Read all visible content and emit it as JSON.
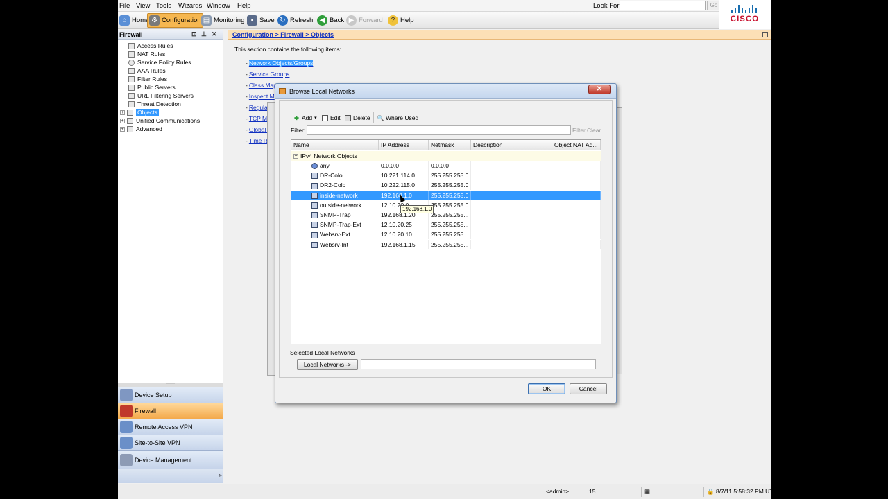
{
  "menubar": {
    "items": [
      "File",
      "View",
      "Tools",
      "Wizards",
      "Window",
      "Help"
    ],
    "look_for_label": "Look For:",
    "go_label": "Go",
    "logo_text": "CISCO"
  },
  "toolbar": {
    "home": "Home",
    "configuration": "Configuration",
    "monitoring": "Monitoring",
    "save": "Save",
    "refresh": "Refresh",
    "back": "Back",
    "forward": "Forward",
    "help": "Help"
  },
  "left_panel": {
    "title": "Firewall",
    "tree": [
      "Access Rules",
      "NAT Rules",
      "Service Policy Rules",
      "AAA Rules",
      "Filter Rules",
      "Public Servers",
      "URL Filtering Servers",
      "Threat Detection",
      "Objects",
      "Unified Communications",
      "Advanced"
    ],
    "selected": "Objects",
    "nav": [
      "Device Setup",
      "Firewall",
      "Remote Access VPN",
      "Site-to-Site VPN",
      "Device Management"
    ],
    "active_nav": "Firewall"
  },
  "content": {
    "breadcrumb": "Configuration > Firewall > Objects",
    "intro": "This section contains the following items:",
    "links": [
      "Network Objects/Groups",
      "Service Groups",
      "Class Maps",
      "Inspect Maps",
      "Regular Expressions",
      "TCP Maps",
      "Global Policies",
      "Time Ranges"
    ],
    "links_visible": [
      "Network Objects/Groups",
      "Service Groups",
      "Class Map",
      "Inspect M",
      "Regular Ex",
      "TCP Ma",
      "Global P",
      "Time Ra"
    ]
  },
  "dialog": {
    "title": "Browse Local Networks",
    "toolbar": {
      "add": "Add",
      "edit": "Edit",
      "delete": "Delete",
      "where_used": "Where Used"
    },
    "filter_label": "Filter:",
    "filter_value": "",
    "filter_button": "Filter",
    "clear_button": "Clear",
    "columns": [
      "Name",
      "IP Address",
      "Netmask",
      "Description",
      "Object NAT Ad..."
    ],
    "group_label": "IPv4 Network Objects",
    "rows": [
      {
        "name": "any",
        "ip": "0.0.0.0",
        "netmask": "0.0.0.0",
        "description": "",
        "nat": "",
        "icon": "any-icon"
      },
      {
        "name": "DR-Colo",
        "ip": "10.221.114.0",
        "netmask": "255.255.255.0",
        "description": "",
        "nat": "",
        "icon": "network-object-icon"
      },
      {
        "name": "DR2-Colo",
        "ip": "10.222.115.0",
        "netmask": "255.255.255.0",
        "description": "",
        "nat": "",
        "icon": "network-object-icon"
      },
      {
        "name": "inside-network",
        "ip": "192.168.1.0",
        "netmask": "255.255.255.0",
        "description": "",
        "nat": "",
        "icon": "network-object-icon"
      },
      {
        "name": "outside-network",
        "ip": "12.10.20.0",
        "netmask": "255.255.255.0",
        "description": "",
        "nat": "",
        "icon": "network-object-icon"
      },
      {
        "name": "SNMP-Trap",
        "ip": "192.168.1.20",
        "netmask": "255.255.255...",
        "description": "",
        "nat": "",
        "icon": "host-object-icon"
      },
      {
        "name": "SNMP-Trap-Ext",
        "ip": "12.10.20.25",
        "netmask": "255.255.255...",
        "description": "",
        "nat": "",
        "icon": "host-object-icon"
      },
      {
        "name": "Websrv-Ext",
        "ip": "12.10.20.10",
        "netmask": "255.255.255...",
        "description": "",
        "nat": "",
        "icon": "host-object-icon"
      },
      {
        "name": "Websrv-Int",
        "ip": "192.168.1.15",
        "netmask": "255.255.255...",
        "description": "",
        "nat": "",
        "icon": "host-object-icon"
      }
    ],
    "selected_row": "inside-network",
    "tooltip": "192.168.1.0",
    "selected_label": "Selected Local Networks",
    "local_networks_button": "Local Networks ->",
    "local_networks_value": "",
    "ok": "OK",
    "cancel": "Cancel"
  },
  "statusbar": {
    "user": "<admin>",
    "privilege": "15",
    "timestamp": "8/7/11 5:58:32 PM UT"
  },
  "colors": {
    "selection": "#3399ff",
    "breadcrumb_bg": "#fce0b6",
    "active_nav": "#f3a94a",
    "logo_red": "#c8102e",
    "logo_blue": "#1a6fb0"
  }
}
